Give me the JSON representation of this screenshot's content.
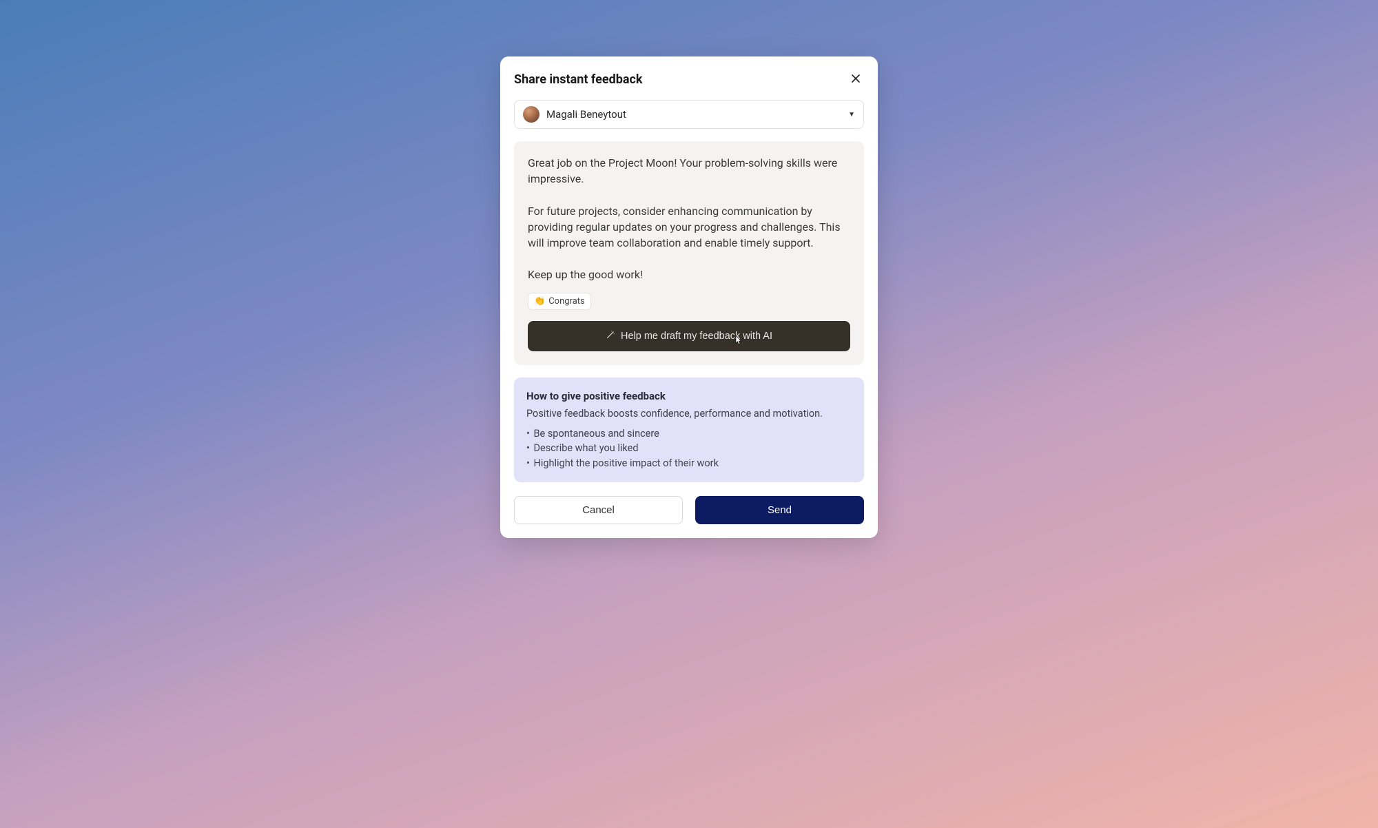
{
  "modal": {
    "title": "Share instant feedback"
  },
  "recipient": {
    "name": "Magali Beneytout"
  },
  "feedback": {
    "text": "Great job on the Project Moon! Your problem-solving skills were impressive.\n\nFor future projects, consider enhancing communication by providing regular updates on your progress and challenges. This will improve team collaboration and enable timely support.\n\nKeep up the good work!",
    "tag_emoji": "👏",
    "tag_label": "Congrats"
  },
  "ai_button": {
    "label": "Help me draft my feedback with AI"
  },
  "tips": {
    "title": "How to give positive feedback",
    "description": "Positive feedback boosts confidence, performance and motivation.",
    "items": [
      "Be spontaneous and sincere",
      "Describe what you liked",
      "Highlight the positive impact of their work"
    ]
  },
  "actions": {
    "cancel": "Cancel",
    "send": "Send"
  }
}
